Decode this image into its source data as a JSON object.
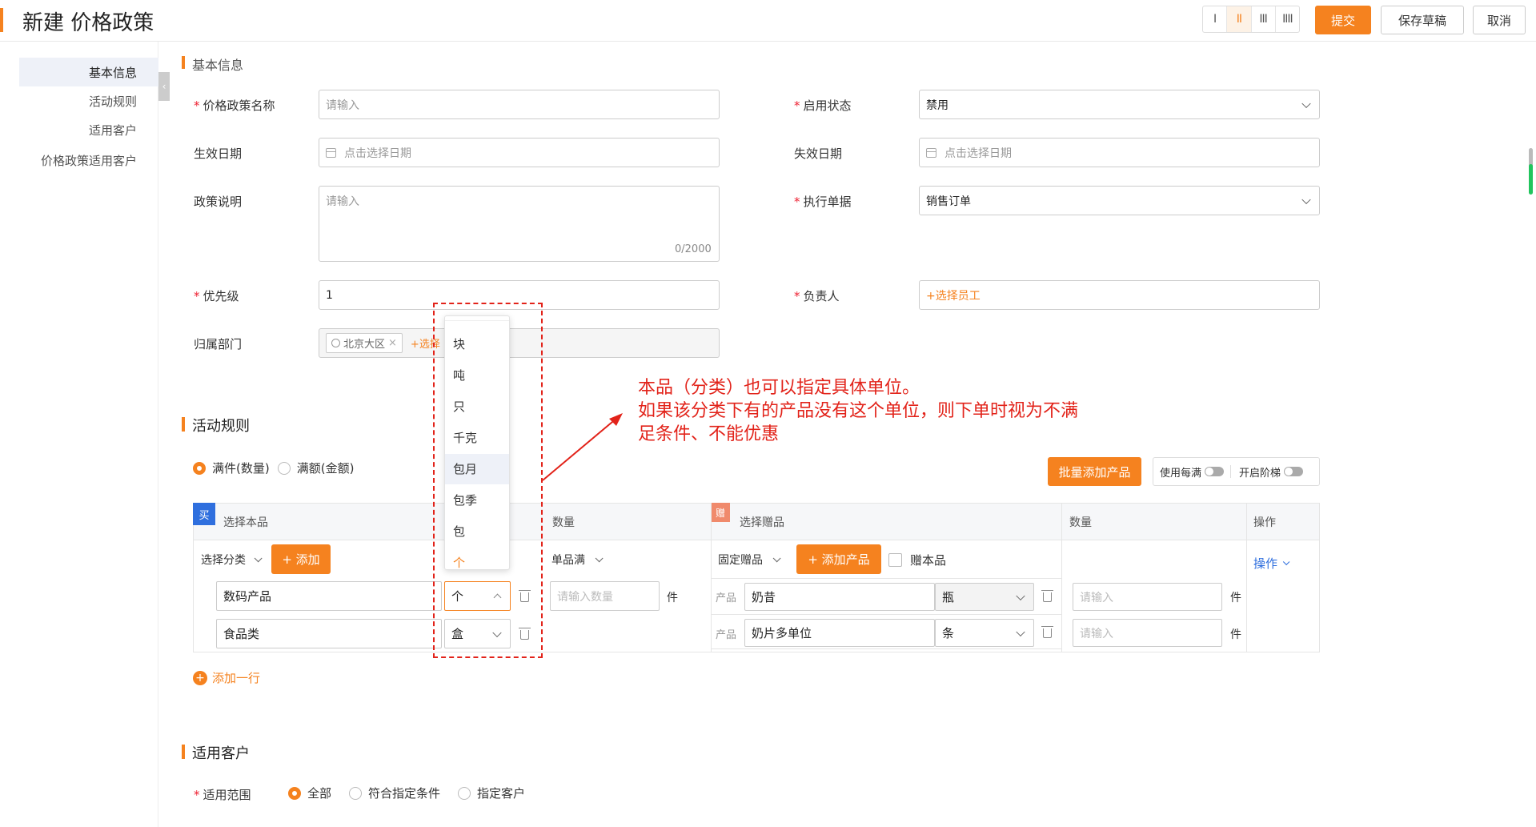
{
  "header": {
    "title": "新建 价格政策",
    "column_toggles": [
      "I",
      "II",
      "III",
      "IIII"
    ],
    "active_column": 1,
    "submit_label": "提交",
    "save_draft_label": "保存草稿",
    "cancel_label": "取消"
  },
  "sidebar": {
    "items": [
      {
        "label": "基本信息",
        "active": true
      },
      {
        "label": "活动规则",
        "active": false
      },
      {
        "label": "适用客户",
        "active": false
      },
      {
        "label": "价格政策适用客户",
        "active": false
      }
    ]
  },
  "basic": {
    "section_title": "基本信息",
    "name_label": "价格政策名称",
    "name_placeholder": "请输入",
    "status_label": "启用状态",
    "status_value": "禁用",
    "start_label": "生效日期",
    "start_placeholder": "点击选择日期",
    "end_label": "失效日期",
    "end_placeholder": "点击选择日期",
    "desc_label": "政策说明",
    "desc_placeholder": "请输入",
    "desc_count": "0/2000",
    "exec_label": "执行单据",
    "exec_value": "销售订单",
    "priority_label": "优先级",
    "priority_value": "1",
    "owner_label": "负责人",
    "owner_placeholder": "+选择员工",
    "dept_label": "归属部门",
    "dept_tag": "北京大区",
    "dept_add": "+选择"
  },
  "rules": {
    "section_title": "活动规则",
    "mode_options": [
      "满件(数量)",
      "满额(金额)"
    ],
    "mode_selected": 0,
    "batch_add_label": "批量添加产品",
    "use_each_label": "使用每满",
    "tier_label": "开启阶梯",
    "buy_badge": "买",
    "gift_badge": "赠",
    "col_select_product": "选择本品",
    "col_qty": "数量",
    "col_select_gift": "选择赠品",
    "col_gift_qty": "数量",
    "col_ops": "操作",
    "category_select": "选择分类",
    "add_label": "+ 添加",
    "qty_mode": "单品满",
    "gift_mode": "固定赠品",
    "add_product_label": "+ 添加产品",
    "gift_self_label": "赠本品",
    "ops_label": "操作",
    "qty_placeholder": "请输入数量",
    "unit_jian": "件",
    "product_prefix": "产品",
    "gift_qty_placeholder": "请输入",
    "rows": [
      {
        "category": "数码产品",
        "unit": "个",
        "gift": "奶昔",
        "gift_unit": "瓶"
      },
      {
        "category": "食品类",
        "unit": "盒",
        "gift": "奶片多单位",
        "gift_unit": "条"
      }
    ],
    "add_row_label": "添加一行"
  },
  "unit_dropdown": {
    "options": [
      "块",
      "吨",
      "只",
      "千克",
      "包月",
      "包季",
      "包",
      "个"
    ],
    "hovered": "包月",
    "selected": "个"
  },
  "customers": {
    "section_title": "适用客户",
    "scope_label": "适用范围",
    "scope_options": [
      "全部",
      "符合指定条件",
      "指定客户"
    ],
    "scope_selected": 0
  },
  "annotation": {
    "lines": [
      "本品（分类）也可以指定具体单位。",
      "如果该分类下有的产品没有这个单位，则下单时视为不满",
      "足条件、不能优惠"
    ]
  }
}
